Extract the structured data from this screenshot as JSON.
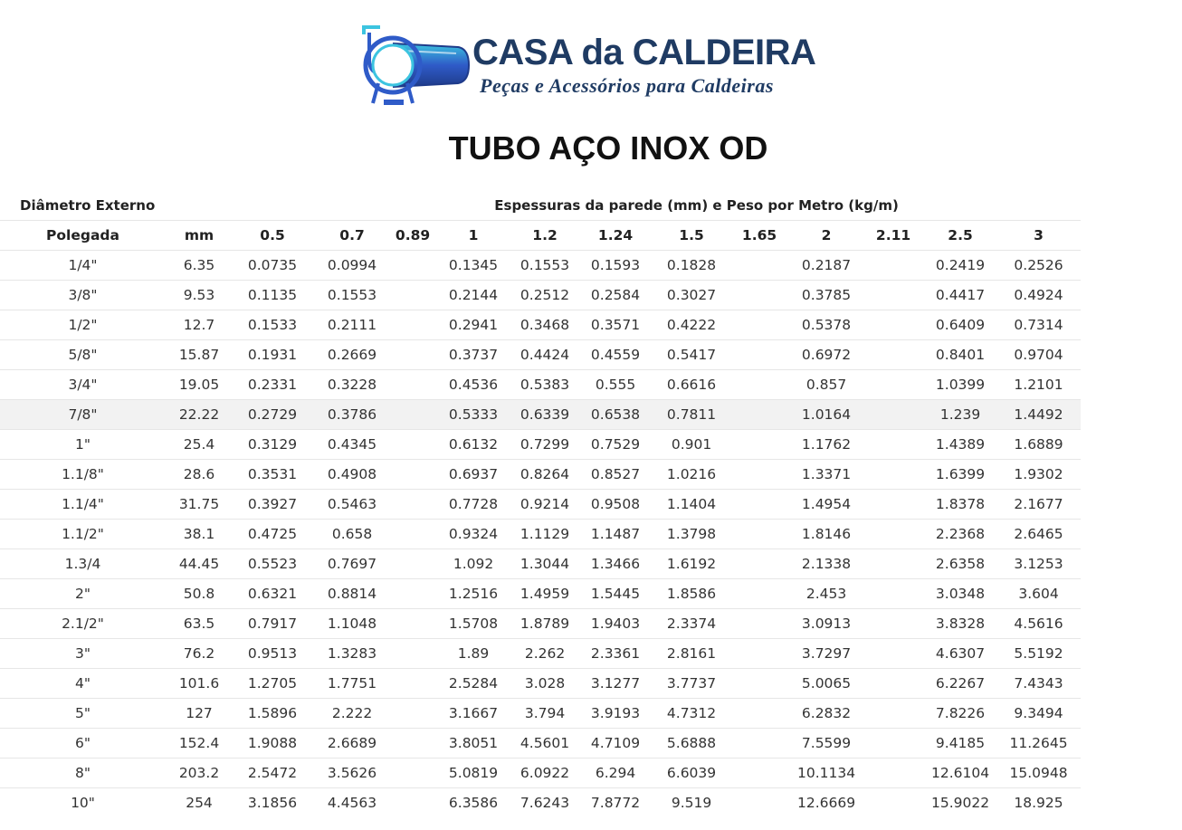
{
  "brand": {
    "name": "CASA da CALDEIRA",
    "tagline": "Peças e Acessórios para Caldeiras"
  },
  "title": "TUBO AÇO INOX OD",
  "table": {
    "group_left": "Diâmetro Externo",
    "group_right": "Espessuras da parede (mm) e Peso por Metro (kg/m)",
    "columns": [
      "Polegada",
      "mm",
      "0.5",
      "0.7",
      "0.89",
      "1",
      "1.2",
      "1.24",
      "1.5",
      "1.65",
      "2",
      "2.11",
      "2.5",
      "3"
    ],
    "highlighted_row": 5,
    "rows": [
      [
        "1/4\"",
        "6.35",
        "0.0735",
        "0.0994",
        "",
        "0.1345",
        "0.1553",
        "0.1593",
        "0.1828",
        "",
        "0.2187",
        "",
        "0.2419",
        "0.2526"
      ],
      [
        "3/8\"",
        "9.53",
        "0.1135",
        "0.1553",
        "",
        "0.2144",
        "0.2512",
        "0.2584",
        "0.3027",
        "",
        "0.3785",
        "",
        "0.4417",
        "0.4924"
      ],
      [
        "1/2\"",
        "12.7",
        "0.1533",
        "0.2111",
        "",
        "0.2941",
        "0.3468",
        "0.3571",
        "0.4222",
        "",
        "0.5378",
        "",
        "0.6409",
        "0.7314"
      ],
      [
        "5/8\"",
        "15.87",
        "0.1931",
        "0.2669",
        "",
        "0.3737",
        "0.4424",
        "0.4559",
        "0.5417",
        "",
        "0.6972",
        "",
        "0.8401",
        "0.9704"
      ],
      [
        "3/4\"",
        "19.05",
        "0.2331",
        "0.3228",
        "",
        "0.4536",
        "0.5383",
        "0.555",
        "0.6616",
        "",
        "0.857",
        "",
        "1.0399",
        "1.2101"
      ],
      [
        "7/8\"",
        "22.22",
        "0.2729",
        "0.3786",
        "",
        "0.5333",
        "0.6339",
        "0.6538",
        "0.7811",
        "",
        "1.0164",
        "",
        "1.239",
        "1.4492"
      ],
      [
        "1\"",
        "25.4",
        "0.3129",
        "0.4345",
        "",
        "0.6132",
        "0.7299",
        "0.7529",
        "0.901",
        "",
        "1.1762",
        "",
        "1.4389",
        "1.6889"
      ],
      [
        "1.1/8\"",
        "28.6",
        "0.3531",
        "0.4908",
        "",
        "0.6937",
        "0.8264",
        "0.8527",
        "1.0216",
        "",
        "1.3371",
        "",
        "1.6399",
        "1.9302"
      ],
      [
        "1.1/4\"",
        "31.75",
        "0.3927",
        "0.5463",
        "",
        "0.7728",
        "0.9214",
        "0.9508",
        "1.1404",
        "",
        "1.4954",
        "",
        "1.8378",
        "2.1677"
      ],
      [
        "1.1/2\"",
        "38.1",
        "0.4725",
        "0.658",
        "",
        "0.9324",
        "1.1129",
        "1.1487",
        "1.3798",
        "",
        "1.8146",
        "",
        "2.2368",
        "2.6465"
      ],
      [
        "1.3/4",
        "44.45",
        "0.5523",
        "0.7697",
        "",
        "1.092",
        "1.3044",
        "1.3466",
        "1.6192",
        "",
        "2.1338",
        "",
        "2.6358",
        "3.1253"
      ],
      [
        "2\"",
        "50.8",
        "0.6321",
        "0.8814",
        "",
        "1.2516",
        "1.4959",
        "1.5445",
        "1.8586",
        "",
        "2.453",
        "",
        "3.0348",
        "3.604"
      ],
      [
        "2.1/2\"",
        "63.5",
        "0.7917",
        "1.1048",
        "",
        "1.5708",
        "1.8789",
        "1.9403",
        "2.3374",
        "",
        "3.0913",
        "",
        "3.8328",
        "4.5616"
      ],
      [
        "3\"",
        "76.2",
        "0.9513",
        "1.3283",
        "",
        "1.89",
        "2.262",
        "2.3361",
        "2.8161",
        "",
        "3.7297",
        "",
        "4.6307",
        "5.5192"
      ],
      [
        "4\"",
        "101.6",
        "1.2705",
        "1.7751",
        "",
        "2.5284",
        "3.028",
        "3.1277",
        "3.7737",
        "",
        "5.0065",
        "",
        "6.2267",
        "7.4343"
      ],
      [
        "5\"",
        "127",
        "1.5896",
        "2.222",
        "",
        "3.1667",
        "3.794",
        "3.9193",
        "4.7312",
        "",
        "6.2832",
        "",
        "7.8226",
        "9.3494"
      ],
      [
        "6\"",
        "152.4",
        "1.9088",
        "2.6689",
        "",
        "3.8051",
        "4.5601",
        "4.7109",
        "5.6888",
        "",
        "7.5599",
        "",
        "9.4185",
        "11.2645"
      ],
      [
        "8\"",
        "203.2",
        "2.5472",
        "3.5626",
        "",
        "5.0819",
        "6.0922",
        "6.294",
        "6.6039",
        "",
        "10.1134",
        "",
        "12.6104",
        "15.0948"
      ],
      [
        "10\"",
        "254",
        "3.1856",
        "4.4563",
        "",
        "6.3586",
        "7.6243",
        "7.8772",
        "9.519",
        "",
        "12.6669",
        "",
        "15.9022",
        "18.925"
      ]
    ]
  },
  "colors": {
    "brand_navy": "#1f3b63",
    "brand_blue": "#2f5bc8",
    "brand_cyan": "#3cc4e0",
    "row_highlight": "#f2f2f2",
    "grid_line": "#e6e6e6"
  }
}
